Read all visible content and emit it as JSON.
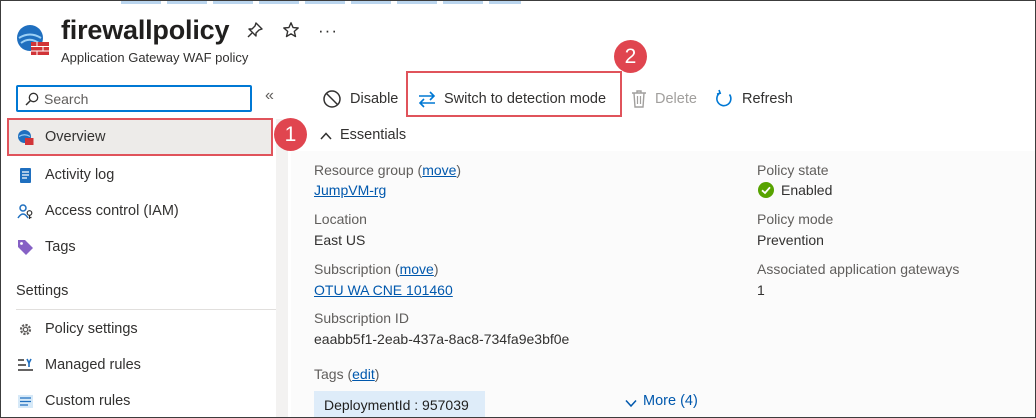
{
  "resource": {
    "title": "firewallpolicy",
    "subtitle": "Application Gateway WAF policy",
    "icon": "waf-policy-icon",
    "more_label": "···"
  },
  "sidebar": {
    "search_placeholder": "Search",
    "collapse_label": "«",
    "items": [
      {
        "label": "Overview",
        "icon": "overview-icon",
        "selected": true
      },
      {
        "label": "Activity log",
        "icon": "activity-log-icon"
      },
      {
        "label": "Access control (IAM)",
        "icon": "iam-icon"
      },
      {
        "label": "Tags",
        "icon": "tag-icon"
      }
    ],
    "section_settings": "Settings",
    "settings_items": [
      {
        "label": "Policy settings",
        "icon": "gear-icon"
      },
      {
        "label": "Managed rules",
        "icon": "managed-rules-icon"
      },
      {
        "label": "Custom rules",
        "icon": "custom-rules-icon"
      }
    ]
  },
  "toolbar": {
    "disable": "Disable",
    "switch_mode": "Switch to detection mode",
    "delete": "Delete",
    "refresh": "Refresh"
  },
  "callouts": {
    "one": "1",
    "two": "2"
  },
  "essentials": {
    "title": "Essentials",
    "left": {
      "resource_group_label": "Resource group",
      "resource_group_move_open": " (",
      "resource_group_move": "move",
      "resource_group_move_close": ")",
      "resource_group_value": "JumpVM-rg",
      "location_label": "Location",
      "location_value": "East US",
      "subscription_label": "Subscription",
      "subscription_move_open": " (",
      "subscription_move": "move",
      "subscription_move_close": ")",
      "subscription_value": "OTU WA CNE 101460",
      "subscription_id_label": "Subscription ID",
      "subscription_id_value": "eaabb5f1-2eab-437a-8ac8-734fa9e3bf0e",
      "tags_label": "Tags",
      "tags_edit_open": " (",
      "tags_edit": "edit",
      "tags_edit_close": ")",
      "tag_chip": "DeploymentId : 957039",
      "more_link": "More (4)"
    },
    "right": {
      "policy_state_label": "Policy state",
      "policy_state_value": "Enabled",
      "policy_mode_label": "Policy mode",
      "policy_mode_value": "Prevention",
      "gateways_label": "Associated application gateways",
      "gateways_value": "1"
    }
  },
  "colors": {
    "accent": "#0078d4",
    "highlight": "#e0535b",
    "success": "#57a300",
    "link": "#0058ad"
  }
}
